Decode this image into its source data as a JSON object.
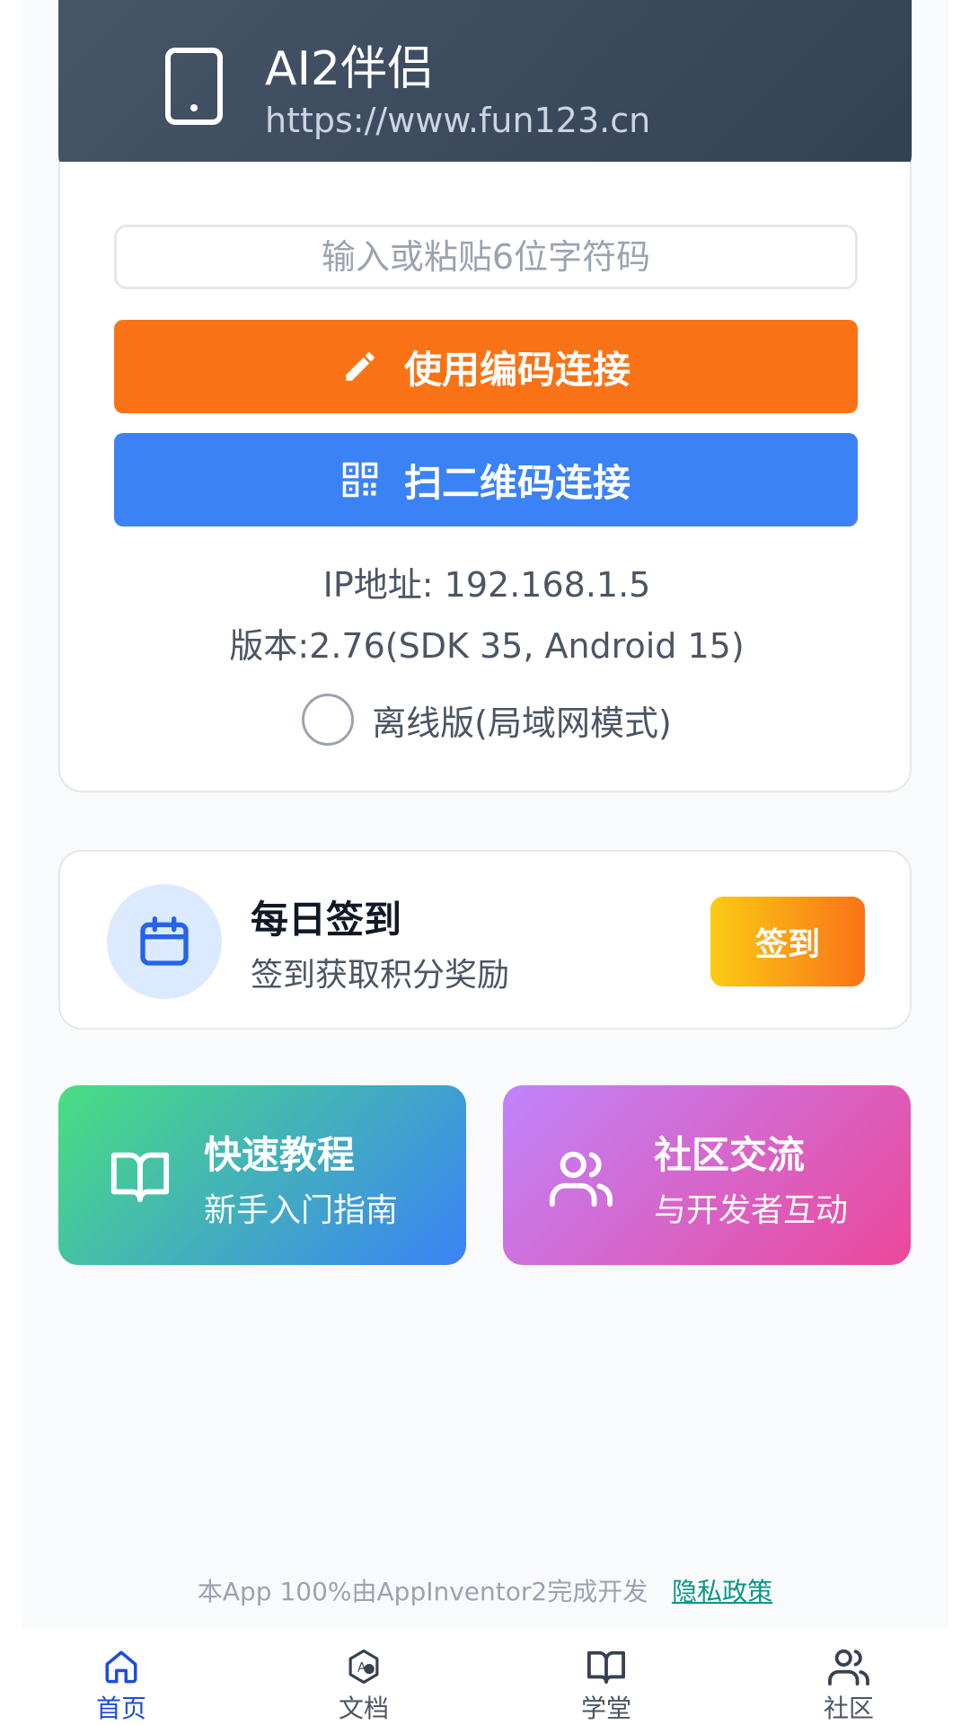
{
  "header": {
    "title": "AI2伴侣",
    "url": "https://www.fun123.cn",
    "icon": "phone-icon"
  },
  "connect": {
    "code_placeholder": "输入或粘贴6位字符码",
    "code_button_label": "使用编码连接",
    "code_button_icon": "pencil-icon",
    "scan_button_label": "扫二维码连接",
    "scan_button_icon": "qr-code-icon",
    "ip_text": "IP地址: 192.168.1.5",
    "version_text": "版本:2.76(SDK 35, Android 15)",
    "offline_label": "离线版(局域网模式)",
    "offline_checked": false
  },
  "checkin": {
    "title": "每日签到",
    "subtitle": "签到获取积分奖励",
    "button_label": "签到",
    "icon": "calendar-icon"
  },
  "tiles": {
    "tutorial": {
      "title": "快速教程",
      "subtitle": "新手入门指南",
      "icon": "book-icon"
    },
    "community": {
      "title": "社区交流",
      "subtitle": "与开发者互动",
      "icon": "users-icon"
    }
  },
  "footer": {
    "text": "本App 100%由AppInventor2完成开发",
    "privacy_link": "隐私政策"
  },
  "nav": {
    "items": [
      {
        "label": "首页",
        "icon": "home-icon",
        "active": true
      },
      {
        "label": "文档",
        "icon": "docs-icon",
        "active": false
      },
      {
        "label": "学堂",
        "icon": "book-icon",
        "active": false
      },
      {
        "label": "社区",
        "icon": "users-icon",
        "active": false
      }
    ]
  },
  "colors": {
    "accent_orange": "#f97316",
    "accent_blue": "#3b82f6",
    "nav_active": "#1d4ed8",
    "link_teal": "#0d9488"
  }
}
